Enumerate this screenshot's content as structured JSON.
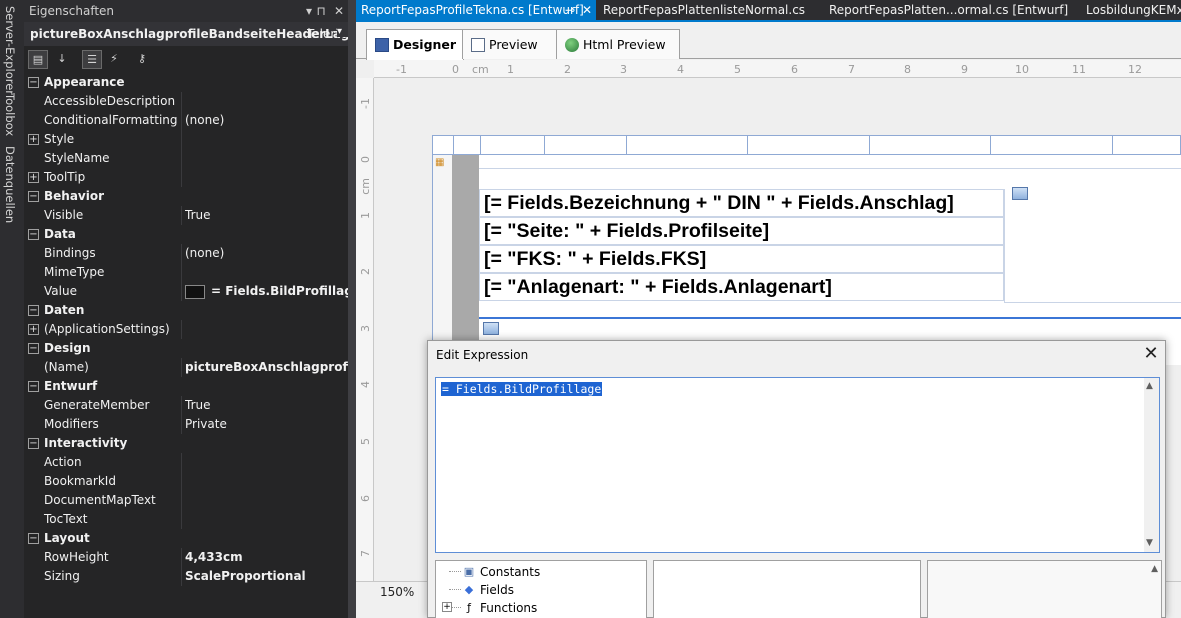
{
  "side_tabs": [
    "Server-Explorer",
    "Toolbox",
    "Datenquellen"
  ],
  "properties": {
    "title": "Eigenschaften",
    "title_icons": [
      "chevron-down-icon",
      "pin-icon",
      "close-icon"
    ],
    "object_name": "pictureBoxAnschlagprofileBandseiteHeaderLage",
    "object_type": "Teleri",
    "toolbar": [
      "categorized-icon",
      "alphabetical-icon",
      "properties-icon",
      "events-icon",
      "property-pages-icon"
    ],
    "rows": [
      {
        "type": "cat",
        "name": "Appearance"
      },
      {
        "type": "prop",
        "name": "AccessibleDescription",
        "value": ""
      },
      {
        "type": "prop",
        "name": "ConditionalFormatting",
        "value": "(none)"
      },
      {
        "type": "prop",
        "name": "Style",
        "value": "",
        "expandable": true
      },
      {
        "type": "prop",
        "name": "StyleName",
        "value": ""
      },
      {
        "type": "prop",
        "name": "ToolTip",
        "value": "",
        "expandable": true
      },
      {
        "type": "cat",
        "name": "Behavior"
      },
      {
        "type": "prop",
        "name": "Visible",
        "value": "True"
      },
      {
        "type": "cat",
        "name": "Data"
      },
      {
        "type": "prop",
        "name": "Bindings",
        "value": "(none)"
      },
      {
        "type": "prop",
        "name": "MimeType",
        "value": ""
      },
      {
        "type": "prop",
        "name": "Value",
        "value": "= Fields.BildProfillage",
        "bold": true,
        "swatch": true
      },
      {
        "type": "cat",
        "name": "Daten"
      },
      {
        "type": "prop",
        "name": "(ApplicationSettings)",
        "value": "",
        "expandable": true
      },
      {
        "type": "cat",
        "name": "Design"
      },
      {
        "type": "prop",
        "name": "(Name)",
        "value": "pictureBoxAnschlagprofileBa",
        "bold": true
      },
      {
        "type": "cat",
        "name": "Entwurf"
      },
      {
        "type": "prop",
        "name": "GenerateMember",
        "value": "True"
      },
      {
        "type": "prop",
        "name": "Modifiers",
        "value": "Private"
      },
      {
        "type": "cat",
        "name": "Interactivity"
      },
      {
        "type": "prop",
        "name": "Action",
        "value": ""
      },
      {
        "type": "prop",
        "name": "BookmarkId",
        "value": ""
      },
      {
        "type": "prop",
        "name": "DocumentMapText",
        "value": ""
      },
      {
        "type": "prop",
        "name": "TocText",
        "value": ""
      },
      {
        "type": "cat",
        "name": "Layout"
      },
      {
        "type": "prop",
        "name": "RowHeight",
        "value": "4,433cm",
        "bold": true
      },
      {
        "type": "prop",
        "name": "Sizing",
        "value": "ScaleProportional",
        "bold": true
      }
    ]
  },
  "doc_tabs": [
    {
      "label": "ReportFepasProfileTekna.cs [Entwurf]",
      "active": true,
      "pin": "⊸",
      "close": "✕"
    },
    {
      "label": "ReportFepasPlattenlisteNormal.cs",
      "active": false
    },
    {
      "label": "ReportFepasPlatten...ormal.cs [Entwurf]",
      "active": false
    },
    {
      "label": "LosbildungKEMx",
      "active": false
    }
  ],
  "view_tabs": [
    {
      "label": "Designer",
      "icon": "designer-icon",
      "active": true
    },
    {
      "label": "Preview",
      "icon": "preview-icon",
      "active": false
    },
    {
      "label": "Html Preview",
      "icon": "globe-icon",
      "active": false
    }
  ],
  "ruler": {
    "h_labels": [
      "-1",
      "0",
      "cm",
      "1",
      "2",
      "3",
      "4",
      "5",
      "6",
      "7",
      "8",
      "9",
      "10",
      "11",
      "12"
    ],
    "v_labels": [
      "-1",
      "0",
      "cm",
      "1",
      "2",
      "3",
      "4",
      "5",
      "6",
      "7"
    ]
  },
  "zoom": "150%",
  "report_fields": [
    "[= Fields.Bezeichnung + \" DIN \" + Fields.Anschlag]",
    "[= \"Seite: \" + Fields.Profilseite]",
    "[= \"FKS: \" + Fields.FKS]",
    "[= \"Anlagenart: \" + Fields.Anlagenart]"
  ],
  "dialog": {
    "title": "Edit Expression",
    "close": "✕",
    "expression": "= Fields.BildProfillage",
    "tree": [
      {
        "label": "Constants",
        "icon": "constants-icon",
        "expander": ""
      },
      {
        "label": "Fields",
        "icon": "fields-icon",
        "expander": ""
      },
      {
        "label": "Functions",
        "icon": "functions-icon",
        "expander": "+"
      }
    ]
  },
  "colors": {
    "accent": "#007acc",
    "selection": "#1e64d2",
    "vs_dark": "#252526"
  }
}
